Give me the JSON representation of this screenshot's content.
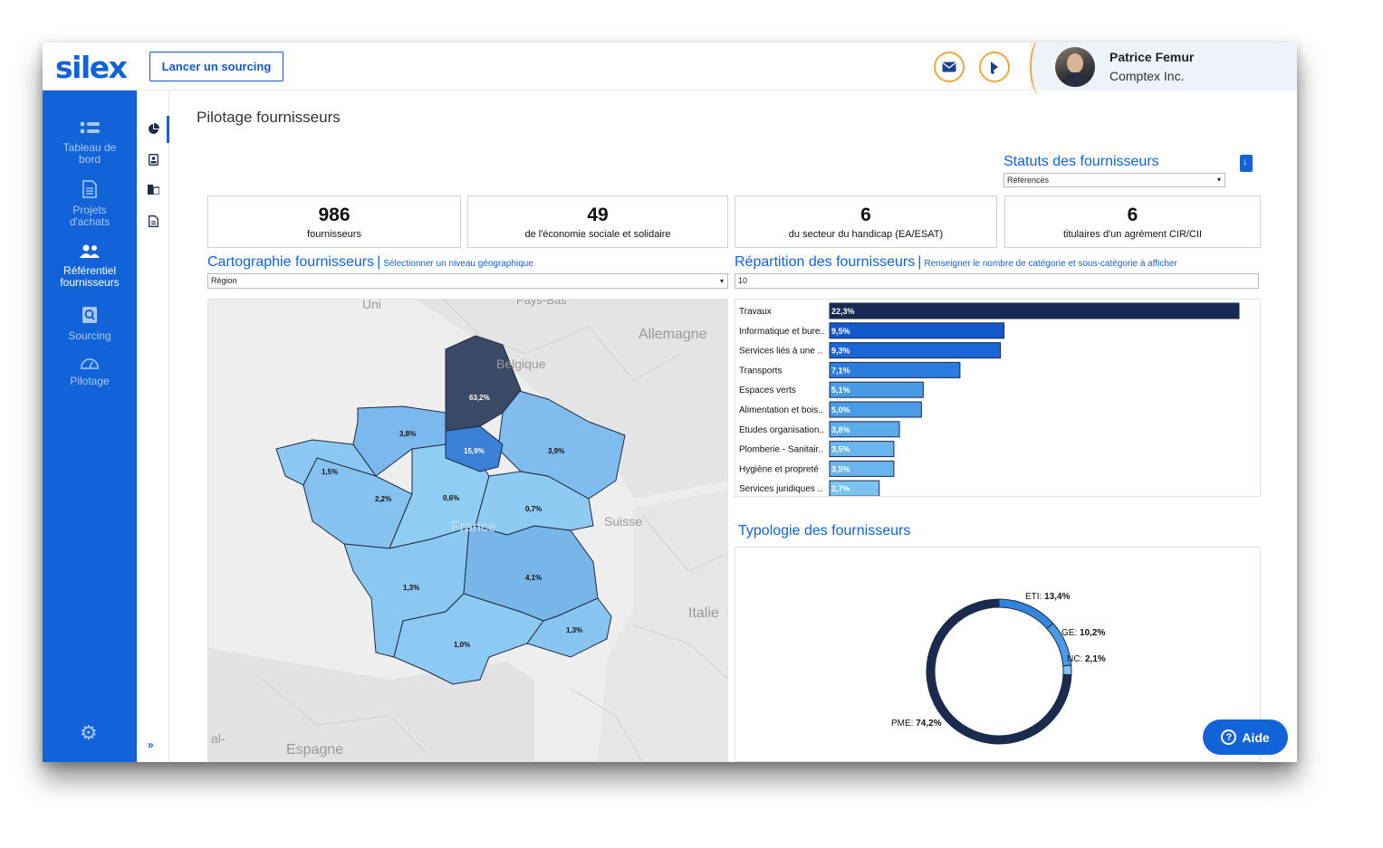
{
  "header": {
    "logo": "silex",
    "launch_button": "Lancer un sourcing",
    "mail_icon": "mail-icon",
    "notification_icon": "bell-icon",
    "user": {
      "name": "Patrice Femur",
      "company": "Comptex Inc."
    }
  },
  "sidebar": {
    "items": [
      {
        "label_1": "Tableau de",
        "label_2": "bord",
        "icon": "list-icon"
      },
      {
        "label_1": "Projets",
        "label_2": "d'achats",
        "icon": "document-icon"
      },
      {
        "label_1": "Référentiel",
        "label_2": "fournisseurs",
        "icon": "users-icon"
      },
      {
        "label_1": "Sourcing",
        "label_2": "",
        "icon": "search-doc-icon"
      },
      {
        "label_1": "Pilotage",
        "label_2": "",
        "icon": "gauge-icon"
      }
    ],
    "settings_icon": "gear-icon",
    "expand_label": "»"
  },
  "page": {
    "title": "Pilotage fournisseurs",
    "statuts": {
      "title": "Statuts des fournisseurs",
      "selected": "Référencés"
    }
  },
  "kpis": [
    {
      "value": "986",
      "label": "fournisseurs"
    },
    {
      "value": "49",
      "label": "de l'économie sociale et solidaire"
    },
    {
      "value": "6",
      "label": "du secteur du handicap (EA/ESAT)"
    },
    {
      "value": "6",
      "label": "titulaires d'un agrément CIR/CII"
    }
  ],
  "cartographie": {
    "title": "Cartographie fournisseurs",
    "separator": "|",
    "hint": "Sélectionner un niveau géographique",
    "selected": "Région",
    "map_labels": {
      "uni": "Uni",
      "pays_bas": "Pays-Bas",
      "allemagne": "Allemagne",
      "belgique": "Belgique",
      "suisse": "Suisse",
      "italie": "Italie",
      "espagne": "Espagne",
      "al": "al-",
      "france": "France"
    },
    "regions": [
      {
        "name": "Hauts-de-France",
        "value": "63,2%",
        "color": "#3a4a66"
      },
      {
        "name": "Île-de-France",
        "value": "15,9%",
        "color": "#3b7fd6"
      },
      {
        "name": "Normandie",
        "value": "3,8%",
        "color": "#7ab8ee"
      },
      {
        "name": "Grand Est",
        "value": "3,9%",
        "color": "#80bdee"
      },
      {
        "name": "Bretagne",
        "value": "1,5%",
        "color": "#8ac8f2"
      },
      {
        "name": "Pays de la Loire",
        "value": "2,2%",
        "color": "#86c2f0"
      },
      {
        "name": "Centre-Val de Loire",
        "value": "0,6%",
        "color": "#90cdf3"
      },
      {
        "name": "Bourgogne-Franche-Comté",
        "value": "0,7%",
        "color": "#8ecbf3"
      },
      {
        "name": "Nouvelle-Aquitaine",
        "value": "1,3%",
        "color": "#8ac8f2"
      },
      {
        "name": "Auvergne-Rhône-Alpes",
        "value": "4,1%",
        "color": "#78b6ea"
      },
      {
        "name": "Occitanie",
        "value": "1,0%",
        "color": "#8dcaf3"
      },
      {
        "name": "Provence-Alpes-Côte d'Azur",
        "value": "1,3%",
        "color": "#88c6f1"
      }
    ]
  },
  "repartition": {
    "title": "Répartition des fournisseurs",
    "separator": "|",
    "hint": "Renseigner le nombre de catégorie et sous-catégorie à afficher",
    "input_value": "10"
  },
  "chart_data": [
    {
      "type": "bar",
      "orientation": "horizontal",
      "categories": [
        "Travaux",
        "Informatique et bure..",
        "Services liés à une ..",
        "Transports",
        "Espaces verts",
        "Alimentation et bois..",
        "Etudes organisation..",
        "Plomberie - Sanitair..",
        "Hygiène et propreté",
        "Services juridiques .."
      ],
      "values": [
        22.3,
        9.5,
        9.3,
        7.1,
        5.1,
        5.0,
        3.8,
        3.5,
        3.5,
        2.7
      ],
      "labels": [
        "22,3%",
        "9,5%",
        "9,3%",
        "7,1%",
        "5,1%",
        "5,0%",
        "3,8%",
        "3,5%",
        "3,5%",
        "2,7%"
      ],
      "colors": [
        "#162a52",
        "#1359cc",
        "#1a66d6",
        "#2a7ddf",
        "#4a9be6",
        "#4a9be6",
        "#5cabea",
        "#6ab5ed",
        "#6ab5ed",
        "#7cc2f1"
      ]
    },
    {
      "type": "pie",
      "title": "Typologie des fournisseurs",
      "slices": [
        {
          "label": "PME",
          "value": 74.2,
          "text": "74,2%",
          "color": "#1a2b4e"
        },
        {
          "label": "ETI",
          "value": 13.4,
          "text": "13,4%",
          "color": "#3584dc"
        },
        {
          "label": "GE",
          "value": 10.2,
          "text": "10,2%",
          "color": "#4a9be6"
        },
        {
          "label": "NC",
          "value": 2.1,
          "text": "2,1%",
          "color": "#7fc4f1"
        }
      ]
    }
  ],
  "aide": {
    "label": "Aide",
    "icon": "question-icon"
  }
}
